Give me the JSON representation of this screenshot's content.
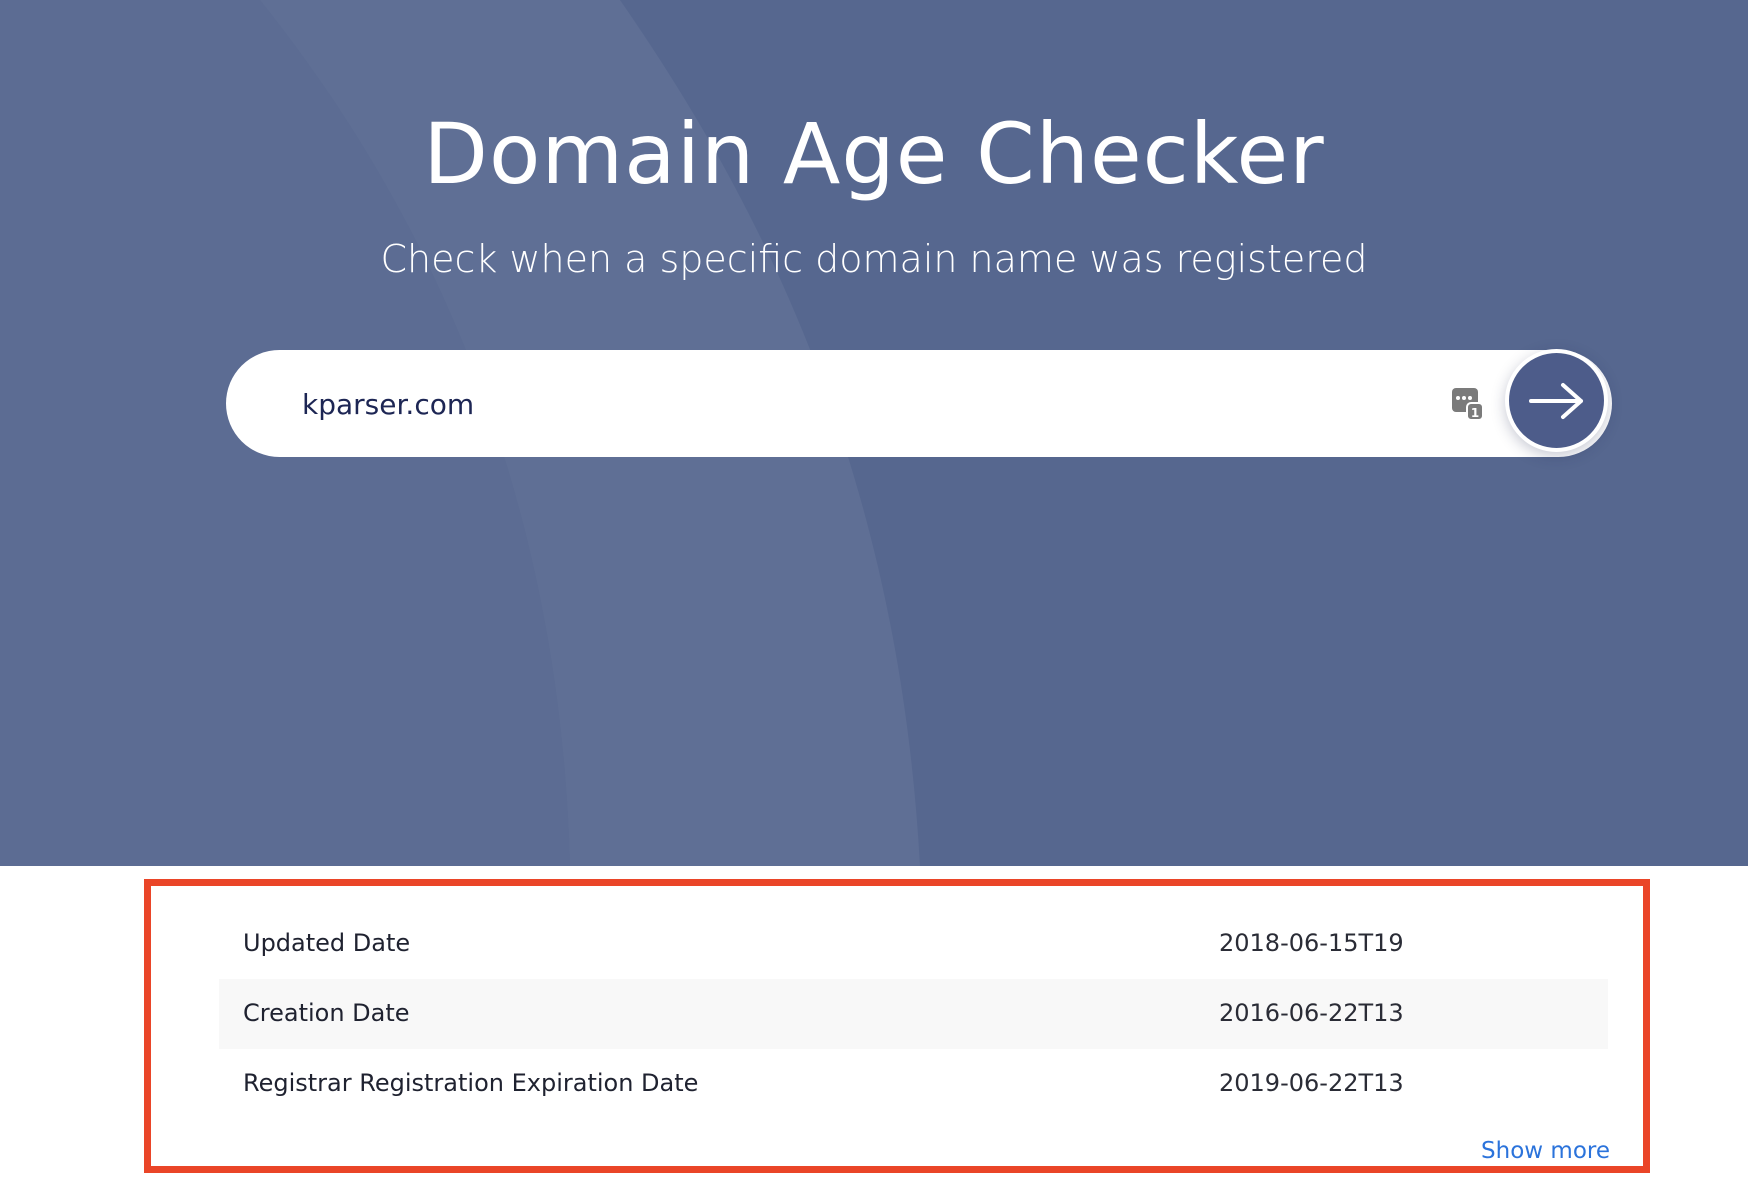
{
  "page": {
    "title": "Domain Age Checker",
    "subtitle": "Check when a specific domain name was registered"
  },
  "search": {
    "value": "kparser.com",
    "extension_icon": "password-manager-icon",
    "submit_icon": "arrow-right-icon"
  },
  "results": {
    "rows": [
      {
        "label": "Updated Date",
        "value": "2018-06-15T19"
      },
      {
        "label": "Creation Date",
        "value": "2016-06-22T13"
      },
      {
        "label": "Registrar Registration Expiration Date",
        "value": "2019-06-22T13"
      }
    ],
    "show_more_label": "Show more"
  },
  "colors": {
    "hero_background": "#56678f",
    "highlight_border": "#ea4528",
    "link": "#2b73db",
    "button": "#4d5c8a"
  }
}
